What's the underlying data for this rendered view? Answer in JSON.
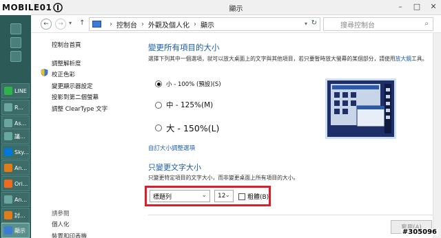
{
  "watermark": {
    "logo": "MOBILE01",
    "id": "#305096"
  },
  "window": {
    "title": "顯示"
  },
  "address": {
    "path": [
      "控制台",
      "外觀及個人化",
      "顯示"
    ],
    "search_placeholder": "搜尋控制台"
  },
  "taskbar": {
    "items": [
      {
        "label": "LINE",
        "color": "#2db34a"
      },
      {
        "label": "R...",
        "color": "#6aa6a0"
      },
      {
        "label": "As...",
        "color": "#6aa6a0"
      },
      {
        "label": "議...",
        "color": "#6aa6a0"
      },
      {
        "label": "Sky...",
        "color": "#0078d7"
      },
      {
        "label": "An...",
        "color": "#e07b1a"
      },
      {
        "label": "Ori...",
        "color": "#f06a1e"
      },
      {
        "label": "An...",
        "color": "#6aa6a0"
      },
      {
        "label": "討...",
        "color": "#e07b1a"
      },
      {
        "label": "顯示",
        "color": "#3a7bd5"
      }
    ]
  },
  "leftpane": {
    "links": [
      "控制台首頁",
      "調整解析度",
      "校正色彩",
      "變更顯示器設定",
      "投影到第二個螢幕",
      "調整 ClearType 文字"
    ],
    "see_also": "請參閱",
    "sub_links": [
      "個人化",
      "裝置和印表機"
    ]
  },
  "main": {
    "heading": "變更所有項目的大小",
    "description": "選擇下列其中一個選項，就可以放大桌面上的文字與其他項目，若只要暫時放大螢幕的某個部分，請使用",
    "description_link": "放大鏡",
    "description_suffix": "工具。",
    "options": [
      {
        "label": "小 - 100% (預設)(S)",
        "selected": true
      },
      {
        "label": "中 - 125%(M)",
        "selected": false
      },
      {
        "label": "大 - 150%(L)",
        "selected": false
      }
    ],
    "custom_link": "自訂大小調整選項",
    "text_heading": "只變更文字大小",
    "text_description": "只變更特定項目的文字大小，而非變更桌面上所有項目的大小。",
    "element_select": "標題列",
    "size_select": "12",
    "bold_label": "粗體(B)",
    "bold_checked": false,
    "apply_label": "套用(A)"
  },
  "colors": {
    "accent": "#1a5ea8",
    "highlight": "#d8202a"
  }
}
